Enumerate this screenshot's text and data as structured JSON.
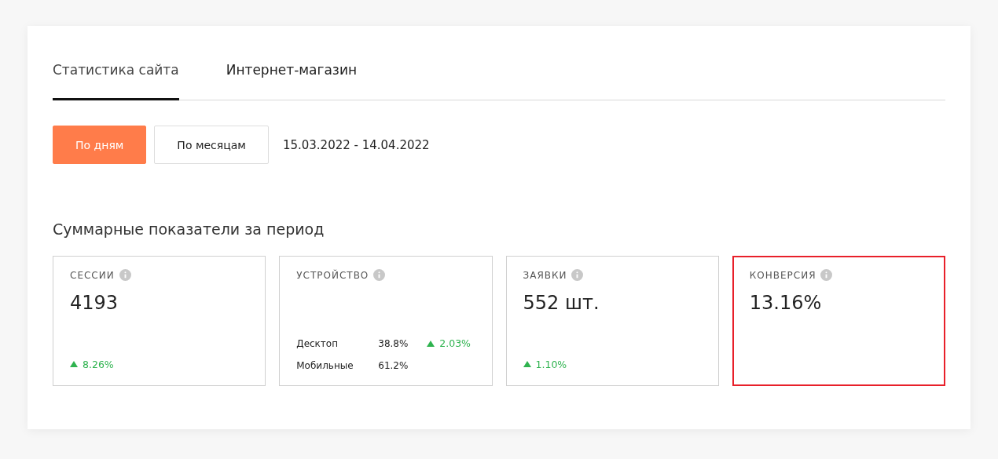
{
  "tabs": [
    {
      "label": "Статистика сайта",
      "selected": true
    },
    {
      "label": "Интернет-магазин",
      "selected": false
    }
  ],
  "period_buttons": [
    {
      "label": "По дням",
      "selected": true
    },
    {
      "label": "По месяцам",
      "selected": false
    }
  ],
  "date_range": "15.03.2022 - 14.04.2022",
  "summary_title": "Суммарные показатели за период",
  "cards": [
    {
      "kind": "metric",
      "title": "СЕССИИ",
      "value": "4193",
      "change": {
        "rising": true,
        "text": "8.26%"
      },
      "highlighted": false
    },
    {
      "kind": "devices",
      "title": "УСТРОЙСТВО",
      "rows": [
        {
          "label": "Десктоп",
          "share": "38.8%",
          "change": {
            "rising": true,
            "text": "2.03%"
          }
        },
        {
          "label": "Мобильные",
          "share": "61.2%"
        }
      ],
      "highlighted": false
    },
    {
      "kind": "metric",
      "title": "ЗАЯВКИ",
      "value": "552 шт.",
      "change": {
        "rising": true,
        "text": "1.10%"
      },
      "highlighted": false
    },
    {
      "kind": "metric",
      "title": "КОНВЕРСИЯ",
      "value": "13.16%",
      "highlighted": true
    }
  ]
}
